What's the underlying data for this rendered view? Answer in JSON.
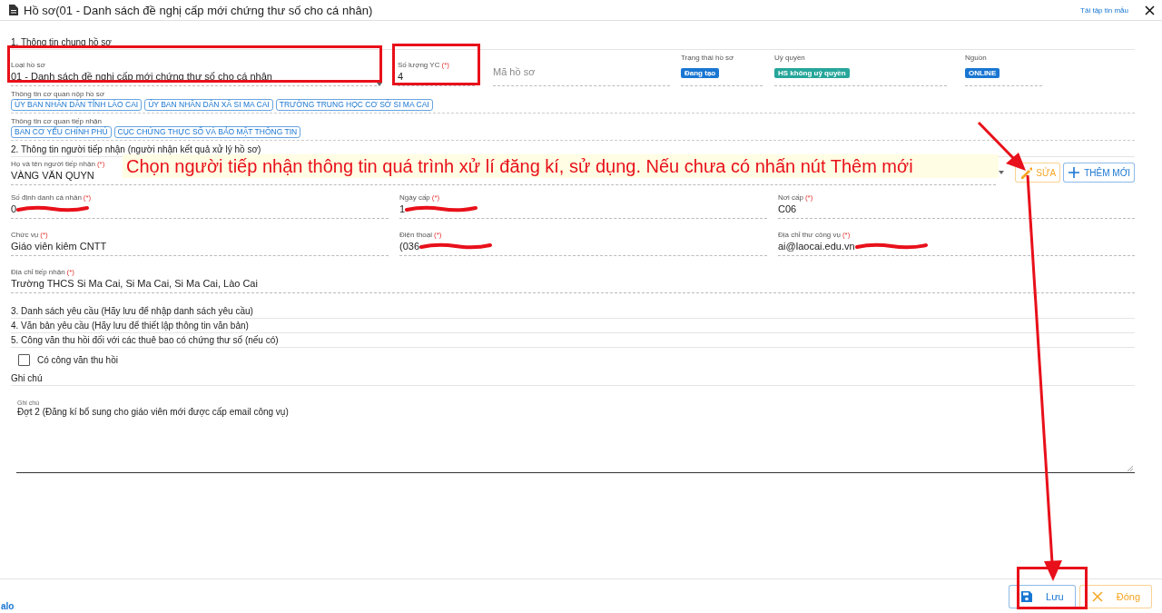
{
  "window": {
    "title": "Hồ sơ(01 - Danh sách đề nghị cấp mới chứng thư số cho cá nhân)",
    "template_link": "Tải tập tin mẫu"
  },
  "section_1": {
    "heading": "1. Thông tin chung hồ sơ",
    "fields": [
      {
        "kind": "select",
        "label": "Loại hồ sơ",
        "value": "01 - Danh sách đề nghị cấp mới chứng thư số cho cá nhân"
      },
      {
        "kind": "input",
        "label": "Số lượng YC",
        "required_mark": "(*)",
        "value": "4"
      },
      {
        "kind": "empty",
        "placeholder": "Mã hồ sơ"
      },
      {
        "kind": "badge",
        "label": "Trạng thái hồ sơ",
        "badge": "Đang tạo",
        "color": "#1976d2"
      },
      {
        "kind": "badge",
        "label": "Uỷ quyền",
        "badge": "HS không uỷ quyền",
        "color": "#26a69a"
      },
      {
        "kind": "badge",
        "label": "Nguồn",
        "badge": "ONLINE",
        "color": "#1976d2"
      }
    ],
    "tag_groups": [
      {
        "label": "Thông tin cơ quan nộp hồ sơ",
        "tags": [
          "ỦY BAN NHÂN DÂN TỈNH LÀO CAI",
          "ỦY BAN NHÂN DÂN XÃ SI MA CAI",
          "TRƯỜNG TRUNG HỌC CƠ SỞ SI MA CAI"
        ]
      },
      {
        "label": "Thông tin cơ quan tiếp nhận",
        "tags": [
          "BAN CƠ YẾU CHÍNH PHỦ",
          "CỤC CHỨNG THỰC SỐ VÀ BẢO MẬT THÔNG TIN"
        ]
      }
    ]
  },
  "section_2": {
    "heading": "2. Thông tin người tiếp nhận (người nhận kết quả xử lý hồ sơ)",
    "recipient": {
      "label": "Họ và tên người tiếp nhận",
      "required_mark": "(*)",
      "value": "VÀNG VĂN QUYN"
    },
    "buttons": [
      {
        "kind": "edit",
        "label": "SỬA"
      },
      {
        "kind": "add",
        "label": "THÊM MỚI"
      }
    ],
    "fields": [
      {
        "label": "Số định danh cá nhân",
        "required_mark": "(*)",
        "value": "0",
        "redacted": true
      },
      {
        "label": "Ngày cấp",
        "required_mark": "(*)",
        "value": "1",
        "redacted": true
      },
      {
        "label": "Nơi cấp",
        "required_mark": "(*)",
        "value": "C06",
        "redacted": false
      },
      {
        "label": "Chức vụ",
        "required_mark": "(*)",
        "value": "Giáo viên kiêm CNTT",
        "redacted": false
      },
      {
        "label": "Điện thoại",
        "required_mark": "(*)",
        "value": "(036",
        "redacted": true
      },
      {
        "label": "Địa chỉ thư công vụ",
        "required_mark": "(*)",
        "value": "ai@laocai.edu.vn",
        "redacted": true
      },
      {
        "label": "Địa chỉ tiếp nhận",
        "required_mark": "(*)",
        "value": "Trường THCS Si Ma Cai, Si Ma Cai, Si Ma Cai, Lào Cai",
        "redacted": false,
        "wide": true
      }
    ]
  },
  "sections": [
    "3. Danh sách yêu cầu (Hãy lưu để nhập danh sách yêu cầu)",
    "4. Văn bản yêu cầu (Hãy lưu để thiết lập thông tin văn bản)",
    "5. Công văn thu hồi đối với các thuê bao có chứng thư số (nếu có)"
  ],
  "checkbox": {
    "label": "Có công văn thu hồi",
    "checked": false
  },
  "notes": {
    "heading": "Ghi chú",
    "label": "Ghi chú",
    "value": "Đợt 2 (Đăng kí bổ sung cho giáo viên mới được cấp email công vụ)"
  },
  "footer": {
    "buttons": [
      {
        "kind": "save",
        "label": "Lưu"
      },
      {
        "kind": "close",
        "label": "Đóng"
      }
    ]
  },
  "chat_widget": {
    "label": "alo"
  },
  "annotation": {
    "callout": "Chọn người tiếp nhận thông tin quá trình xử lí đăng kí, sử dụng. Nếu chưa có nhấn nút Thêm mới"
  }
}
